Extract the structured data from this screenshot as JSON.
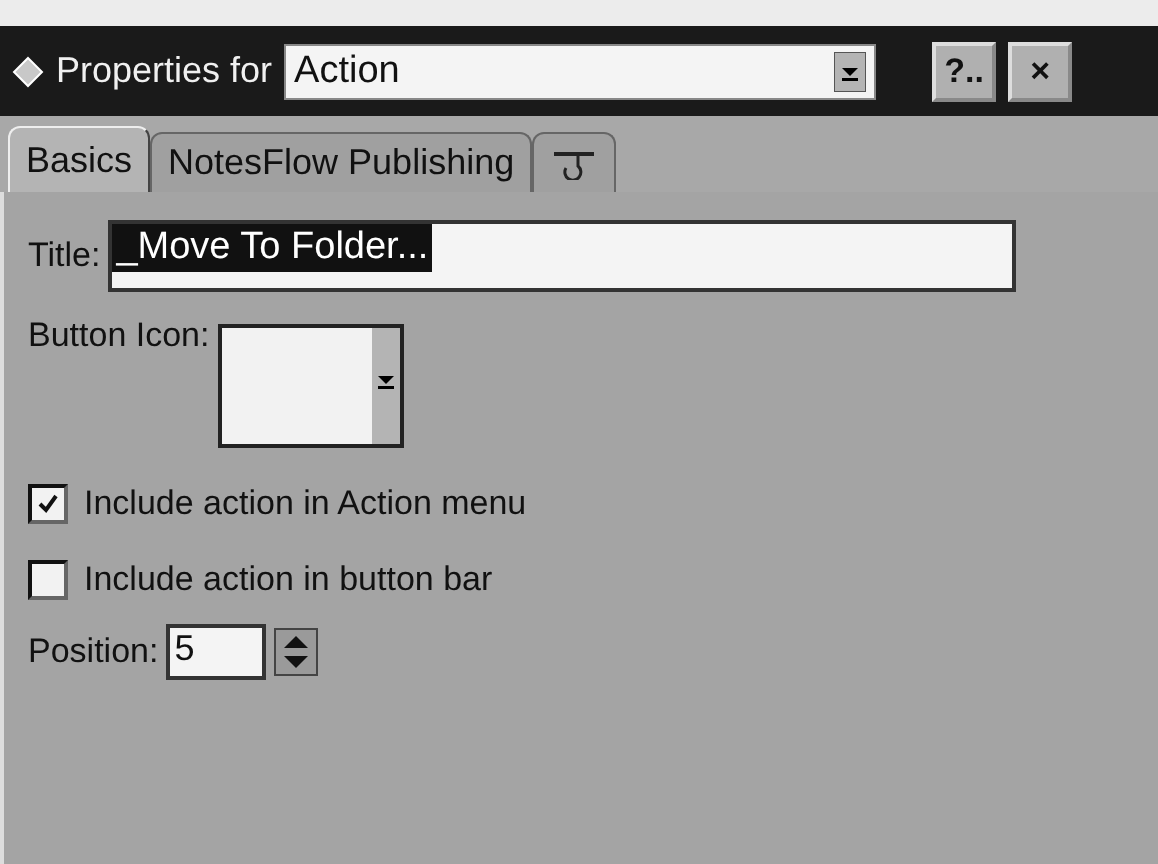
{
  "window": {
    "title": "Properties for",
    "selector": "Action",
    "help_button": "?..",
    "close_button": "×"
  },
  "tabs": [
    {
      "label": "Basics",
      "kind": "text",
      "selected": true
    },
    {
      "label": "NotesFlow Publishing",
      "kind": "text",
      "selected": false
    },
    {
      "kind": "icon",
      "selected": false
    }
  ],
  "title_field": {
    "label": "Title:",
    "value": "_Move To Folder..."
  },
  "button_icon": {
    "label": "Button Icon:"
  },
  "options": [
    {
      "label": "Include action in Action menu",
      "checked": true
    },
    {
      "label": "Include action in button bar",
      "checked": false
    }
  ],
  "position": {
    "label": "Position:",
    "value": "5"
  }
}
